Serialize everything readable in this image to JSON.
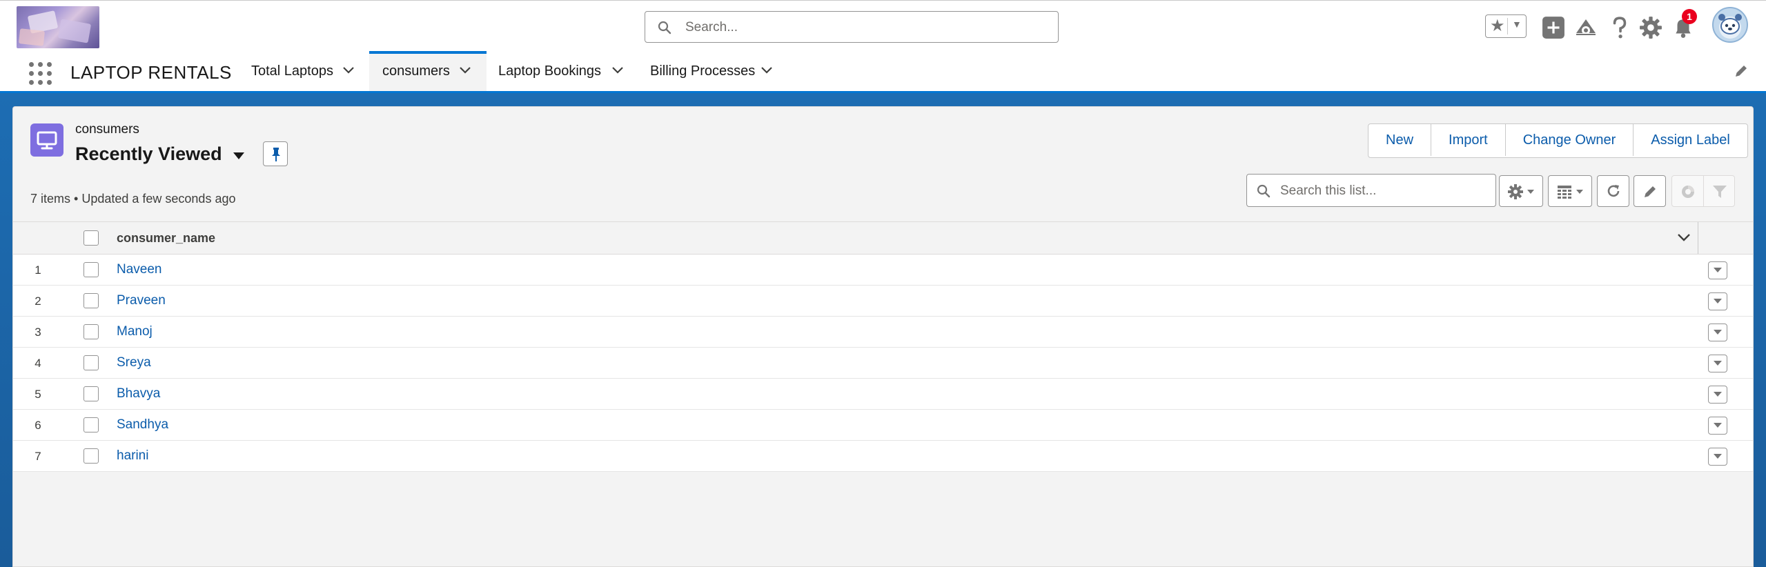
{
  "header": {
    "search_placeholder": "Search...",
    "notification_count": "1"
  },
  "nav": {
    "app_name": "LAPTOP RENTALS",
    "tabs": [
      {
        "label": "Total Laptops",
        "active": false
      },
      {
        "label": "consumers",
        "active": true
      },
      {
        "label": "Laptop Bookings",
        "active": false
      },
      {
        "label": "Billing Processes",
        "active": false
      }
    ]
  },
  "list_view": {
    "object_label": "consumers",
    "title": "Recently Viewed",
    "meta": "7 items • Updated a few seconds ago",
    "search_placeholder": "Search this list...",
    "buttons": [
      "New",
      "Import",
      "Change Owner",
      "Assign Label"
    ]
  },
  "table": {
    "column": "consumer_name",
    "rows": [
      {
        "num": "1",
        "name": "Naveen"
      },
      {
        "num": "2",
        "name": "Praveen"
      },
      {
        "num": "3",
        "name": "Manoj"
      },
      {
        "num": "4",
        "name": "Sreya"
      },
      {
        "num": "5",
        "name": "Bhavya"
      },
      {
        "num": "6",
        "name": "Sandhya"
      },
      {
        "num": "7",
        "name": "harini"
      }
    ]
  },
  "colors": {
    "brand_blue": "#0176d3",
    "link_blue": "#0b5cab",
    "object_icon": "#7e6ee0",
    "badge_red": "#ea001e"
  },
  "icons": [
    "search-icon",
    "favorites-star-icon",
    "add-icon",
    "trailhead-icon",
    "help-icon",
    "setup-gear-icon",
    "bell-icon",
    "avatar",
    "app-launcher-icon",
    "pencil-icon",
    "pin-icon",
    "settings-gear-icon",
    "table-display-icon",
    "refresh-icon",
    "chart-icon",
    "filter-icon",
    "chevron-down-icon"
  ]
}
